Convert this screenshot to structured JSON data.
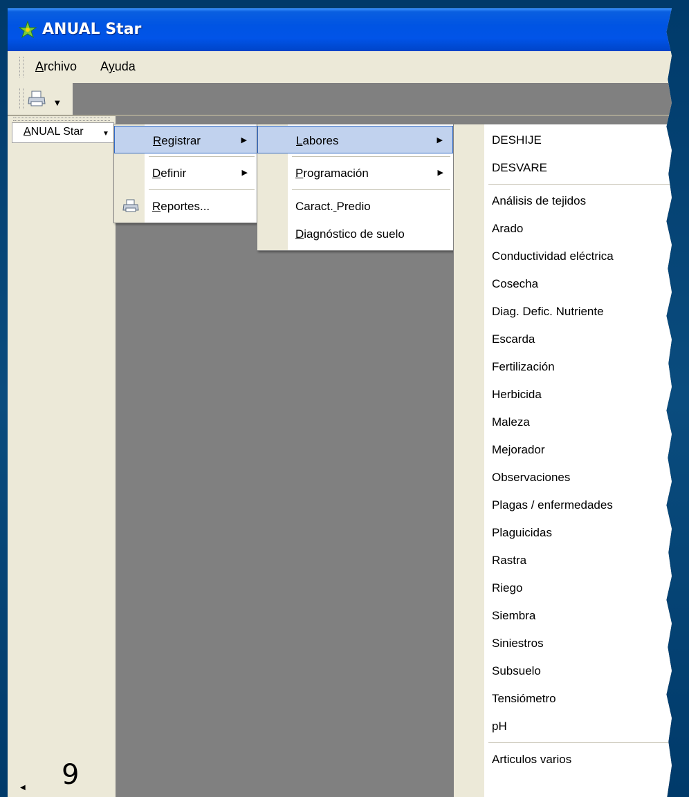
{
  "window": {
    "title": "ANUAL Star"
  },
  "menubar": {
    "items": [
      "Archivo",
      "Ayuda"
    ]
  },
  "nav": {
    "button_label": "ANUAL Star"
  },
  "footer": {
    "page_number": "9"
  },
  "menu_level1": {
    "items": [
      {
        "label": "Registrar",
        "has_submenu": true,
        "highlighted": true
      },
      {
        "label": "Definir",
        "has_submenu": true,
        "highlighted": false
      },
      {
        "label": "Reportes...",
        "has_submenu": false,
        "highlighted": false,
        "icon": "printer-icon"
      }
    ]
  },
  "menu_level2": {
    "items": [
      {
        "label": "Labores",
        "has_submenu": true,
        "highlighted": true
      },
      {
        "label": "Programación",
        "has_submenu": true,
        "highlighted": false
      },
      {
        "label": "Caract. Predio",
        "has_submenu": false,
        "highlighted": false
      },
      {
        "label": "Diagnóstico de suelo",
        "has_submenu": false,
        "highlighted": false
      }
    ]
  },
  "menu_level3": {
    "items": [
      "DESHIJE",
      "DESVARE",
      "Análisis de tejidos",
      "Arado",
      "Conductividad eléctrica",
      "Cosecha",
      "Diag. Defic. Nutriente",
      "Escarda",
      "Fertilización",
      "Herbicida",
      "Maleza",
      "Mejorador",
      "Observaciones",
      "Plagas / enfermedades",
      "Plaguicidas",
      "Rastra",
      "Riego",
      "Siembra",
      "Siniestros",
      "Subsuelo",
      "Tensiómetro",
      "pH",
      "Articulos varios"
    ]
  },
  "colors": {
    "titlebar": "#0054e3",
    "workspace": "#808080",
    "menu_highlight": "#c1d2ee",
    "slide_bg": "#003a6a"
  }
}
